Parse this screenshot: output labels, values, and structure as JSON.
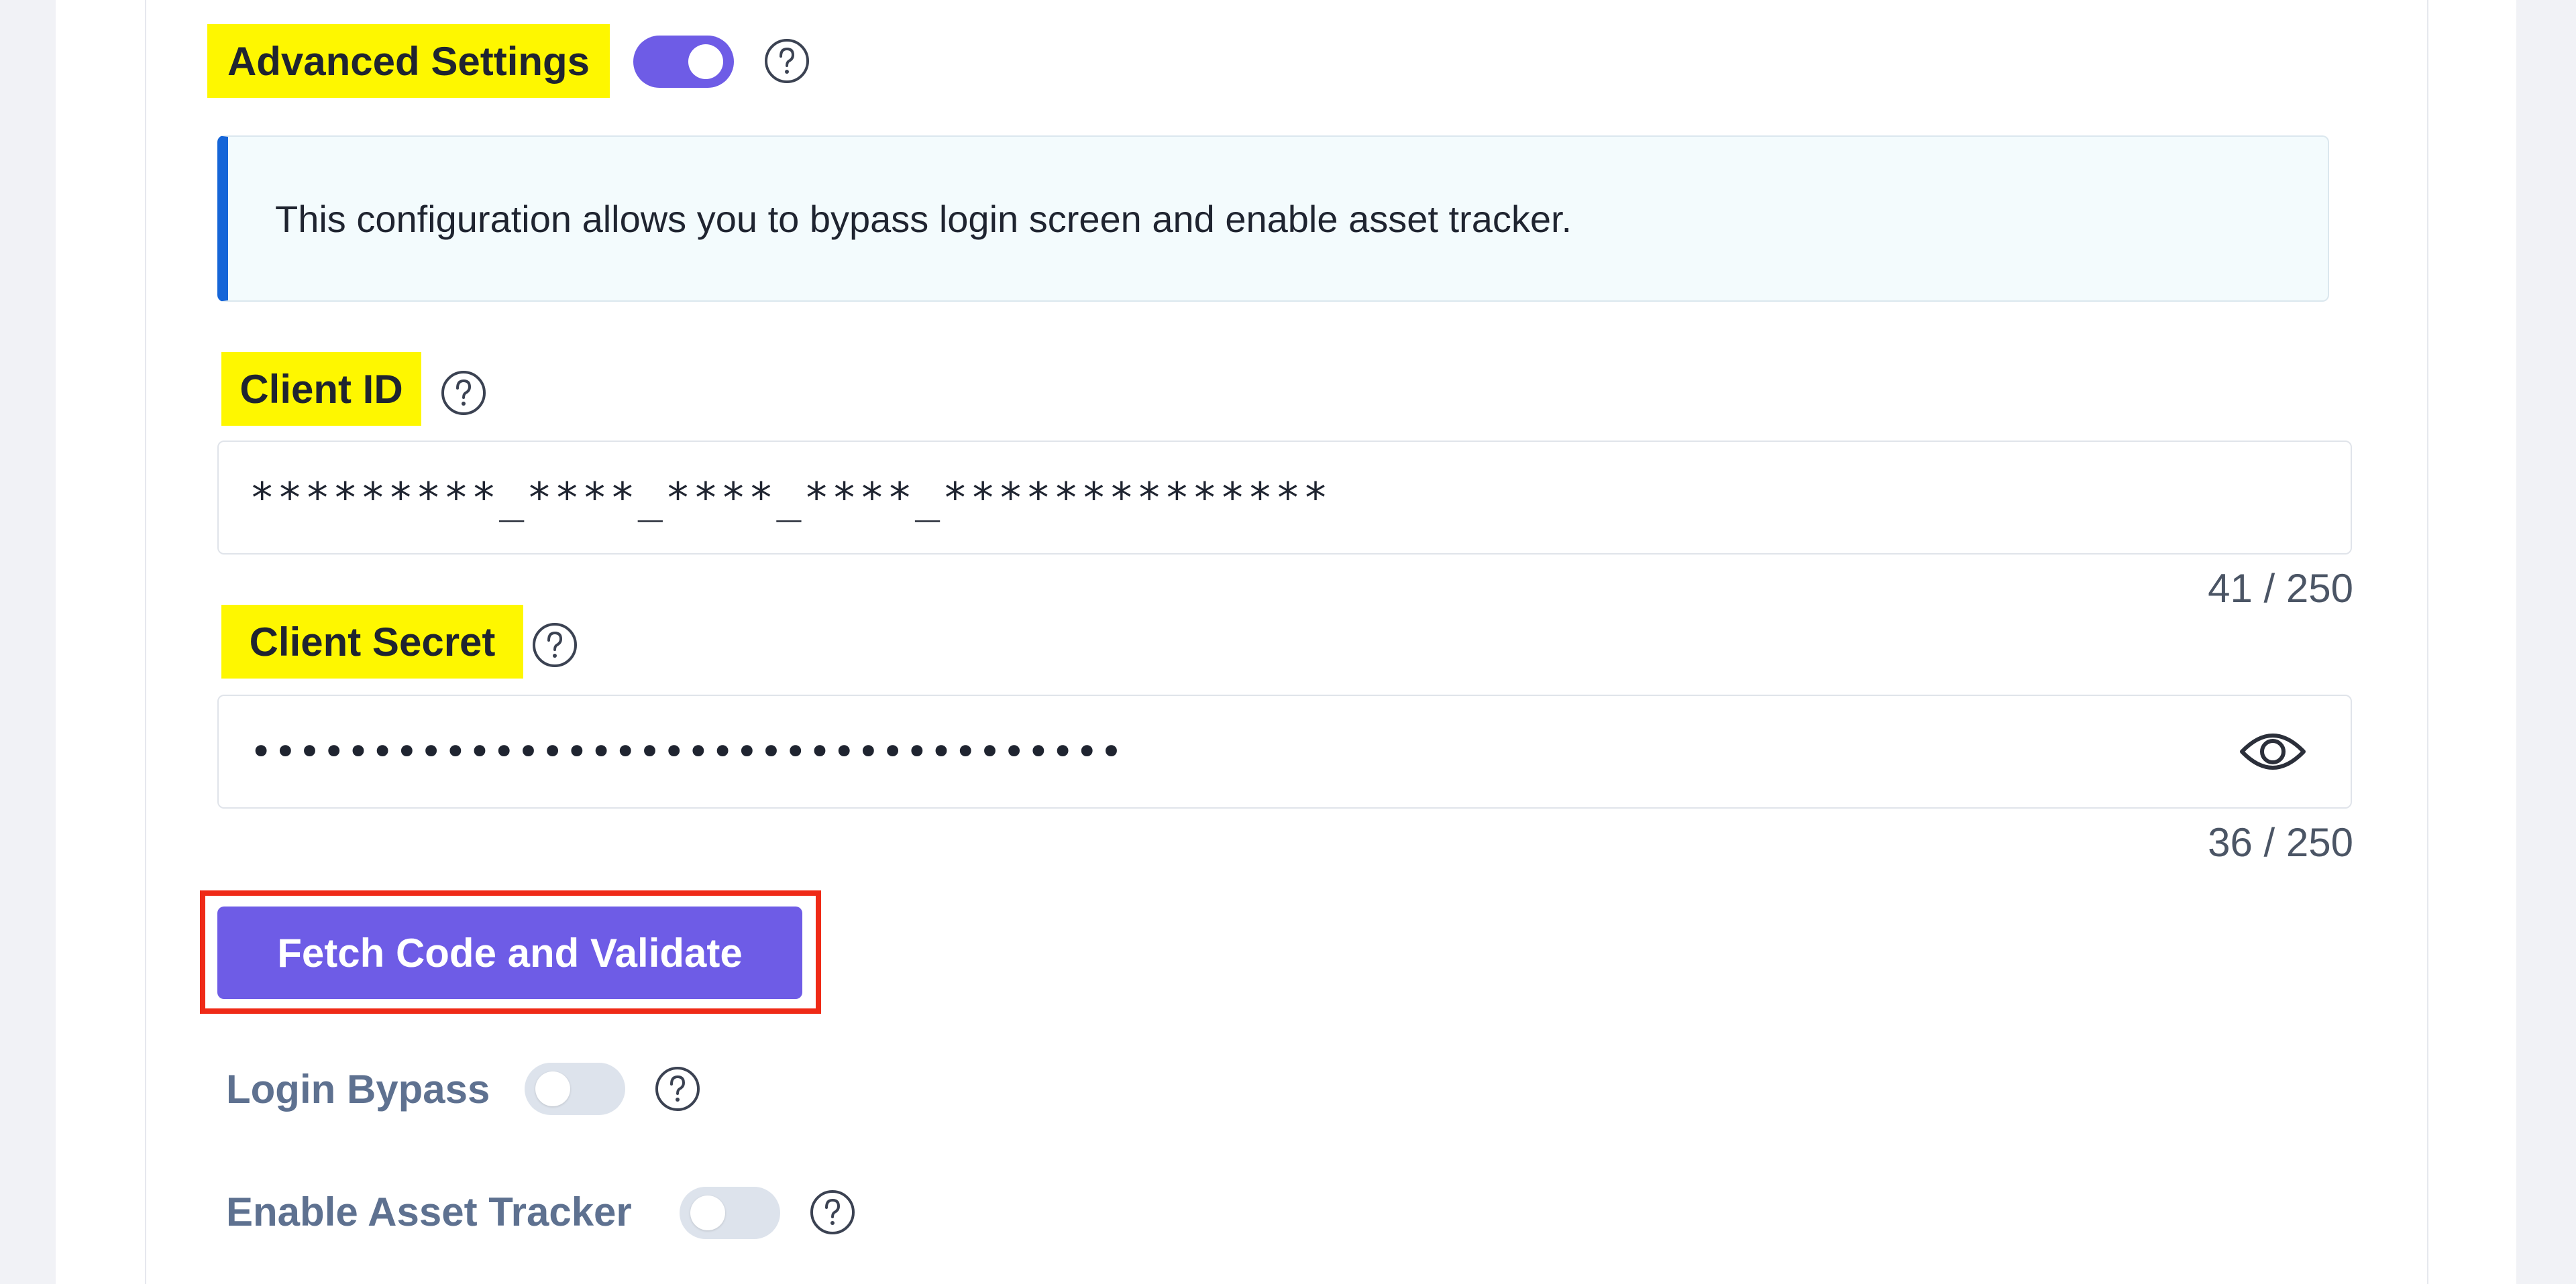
{
  "advanced_settings": {
    "label": "Advanced Settings",
    "enabled": true
  },
  "info": {
    "text": "This configuration allows you to bypass login screen and enable asset tracker."
  },
  "client_id": {
    "label": "Client ID",
    "value": "*********_****_****_****_**************",
    "counter": "41 / 250"
  },
  "client_secret": {
    "label": "Client Secret",
    "value": "••••••••••••••••••••••••••••••••••••",
    "counter": "36 / 250"
  },
  "fetch_button": {
    "label": "Fetch Code and Validate"
  },
  "login_bypass": {
    "label": "Login Bypass",
    "enabled": false
  },
  "asset_tracker": {
    "label": "Enable Asset Tracker",
    "enabled": false
  },
  "colors": {
    "accent": "#6e5ce6",
    "highlight": "#fef700",
    "info_border": "#1565d8",
    "annotation_frame": "#ef2a17"
  },
  "icons": {
    "help": "question-circle-icon",
    "reveal": "eye-icon"
  }
}
